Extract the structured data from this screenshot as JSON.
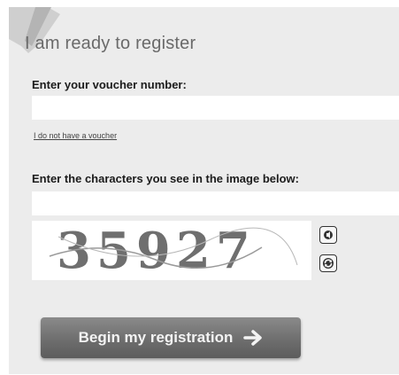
{
  "form": {
    "title": "I am ready to register",
    "voucher_label": "Enter your voucher number:",
    "voucher_value": "",
    "no_voucher_link": "I do not have a voucher",
    "captcha_label": "Enter the characters you see in the image below:",
    "captcha_value": "",
    "captcha_image_text": "35927",
    "submit_label": "Begin my registration"
  },
  "icons": {
    "audio": "audio-icon",
    "refresh": "refresh-icon",
    "submit_arrow": "arrow-right-icon"
  },
  "colors": {
    "panel_background": "#ececec",
    "button_gradient_top": "#8a8a8a",
    "button_gradient_bottom": "#5c5c5c",
    "button_text": "#f3f3f3"
  }
}
